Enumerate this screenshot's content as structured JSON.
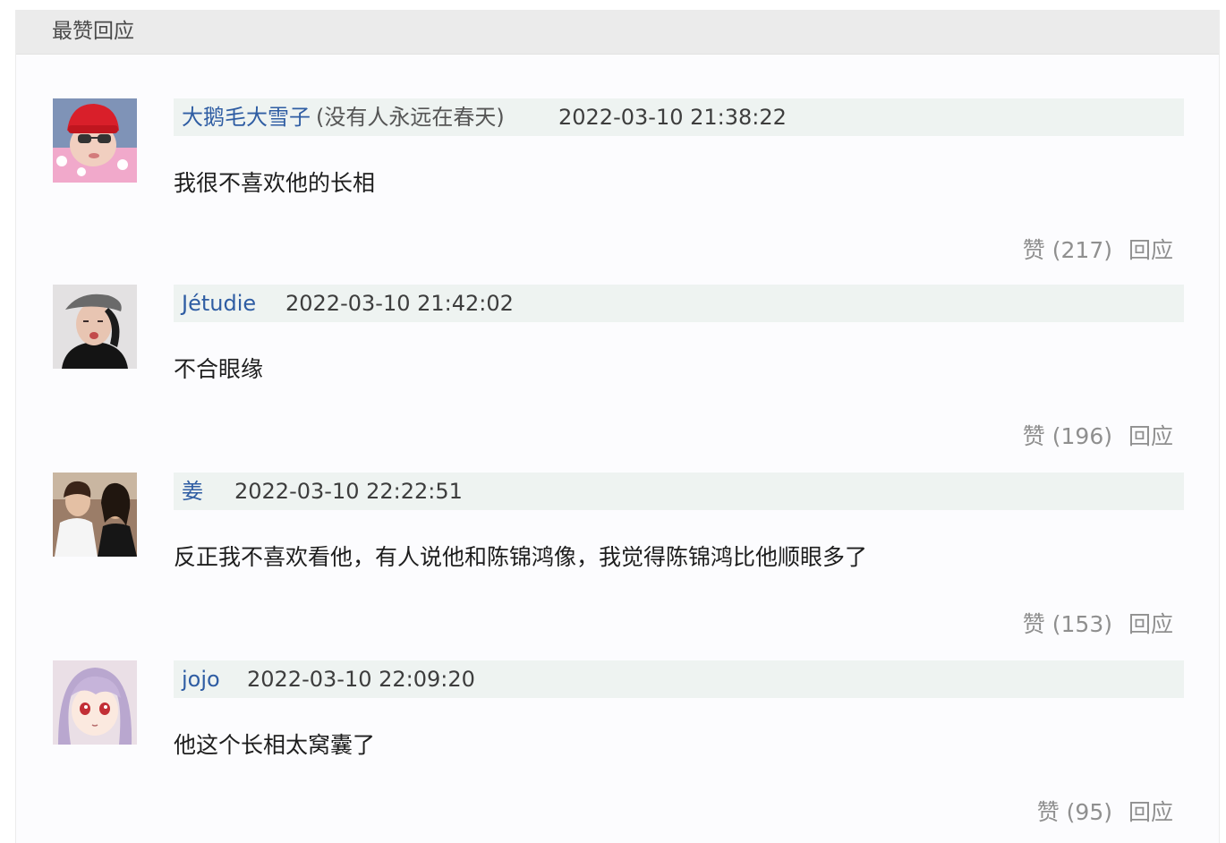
{
  "section": {
    "title": "最赞回应"
  },
  "comments": [
    {
      "author": "大鹅毛大雪子",
      "signature": "(没有人永远在春天)",
      "time": "2022-03-10 21:38:22",
      "content": "我很不喜欢他的长相",
      "like_label": "赞",
      "like_count": "(217)",
      "reply_label": "回应"
    },
    {
      "author": "Jétudie",
      "signature": "",
      "time": "2022-03-10 21:42:02",
      "content": "不合眼缘",
      "like_label": "赞",
      "like_count": "(196)",
      "reply_label": "回应"
    },
    {
      "author": "姜",
      "signature": "",
      "time": "2022-03-10 22:22:51",
      "content": "反正我不喜欢看他，有人说他和陈锦鸿像，我觉得陈锦鸿比他顺眼多了",
      "like_label": "赞",
      "like_count": "(153)",
      "reply_label": "回应"
    },
    {
      "author": "jojo",
      "signature": "",
      "time": "2022-03-10 22:09:20",
      "content": "他这个长相太窝囊了",
      "like_label": "赞",
      "like_count": "(95)",
      "reply_label": "回应"
    }
  ],
  "colors": {
    "author_link": "#2f5da3",
    "meta_bar": "#eef3f1",
    "header_bar": "#ebebeb",
    "action_gray": "#8f8f8f"
  }
}
